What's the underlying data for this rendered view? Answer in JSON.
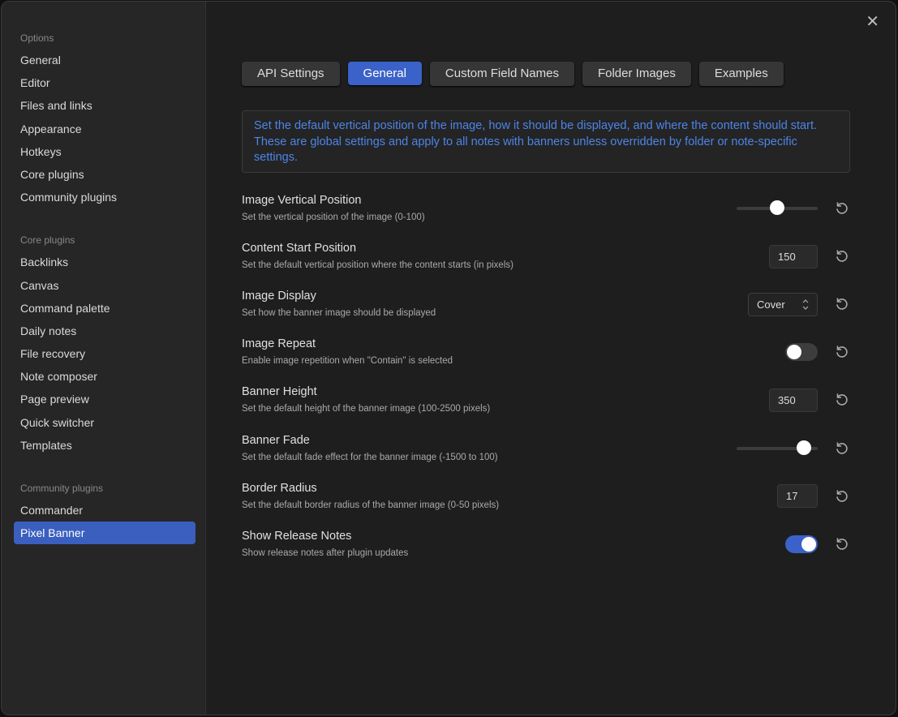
{
  "sidebar": {
    "groups": [
      {
        "title": "Options",
        "items": [
          "General",
          "Editor",
          "Files and links",
          "Appearance",
          "Hotkeys",
          "Core plugins",
          "Community plugins"
        ]
      },
      {
        "title": "Core plugins",
        "items": [
          "Backlinks",
          "Canvas",
          "Command palette",
          "Daily notes",
          "File recovery",
          "Note composer",
          "Page preview",
          "Quick switcher",
          "Templates"
        ]
      },
      {
        "title": "Community plugins",
        "items": [
          "Commander",
          "Pixel Banner"
        ]
      }
    ],
    "active": "Pixel Banner"
  },
  "tabs": [
    "API Settings",
    "General",
    "Custom Field Names",
    "Folder Images",
    "Examples"
  ],
  "active_tab": "General",
  "info": "Set the default vertical position of the image, how it should be displayed, and where the content should start. These are global settings and apply to all notes with banners unless overridden by folder or note-specific settings.",
  "settings": [
    {
      "name": "Image Vertical Position",
      "desc": "Set the vertical position of the image (0-100)",
      "type": "slider",
      "value": 50,
      "min": 0,
      "max": 100
    },
    {
      "name": "Content Start Position",
      "desc": "Set the default vertical position where the content starts (in pixels)",
      "type": "number",
      "value": "150"
    },
    {
      "name": "Image Display",
      "desc": "Set how the banner image should be displayed",
      "type": "select",
      "value": "Cover"
    },
    {
      "name": "Image Repeat",
      "desc": "Enable image repetition when \"Contain\" is selected",
      "type": "toggle",
      "value": false
    },
    {
      "name": "Banner Height",
      "desc": "Set the default height of the banner image (100-2500 pixels)",
      "type": "number",
      "value": "350"
    },
    {
      "name": "Banner Fade",
      "desc": "Set the default fade effect for the banner image (-1500 to 100)",
      "type": "slider",
      "value": -60,
      "min": -1500,
      "max": 100
    },
    {
      "name": "Border Radius",
      "desc": "Set the default border radius of the banner image (0-50 pixels)",
      "type": "number",
      "value": "17"
    },
    {
      "name": "Show Release Notes",
      "desc": "Show release notes after plugin updates",
      "type": "toggle",
      "value": true
    }
  ],
  "colors": {
    "accent": "#3a62c8",
    "info_text": "#4d84e8"
  }
}
